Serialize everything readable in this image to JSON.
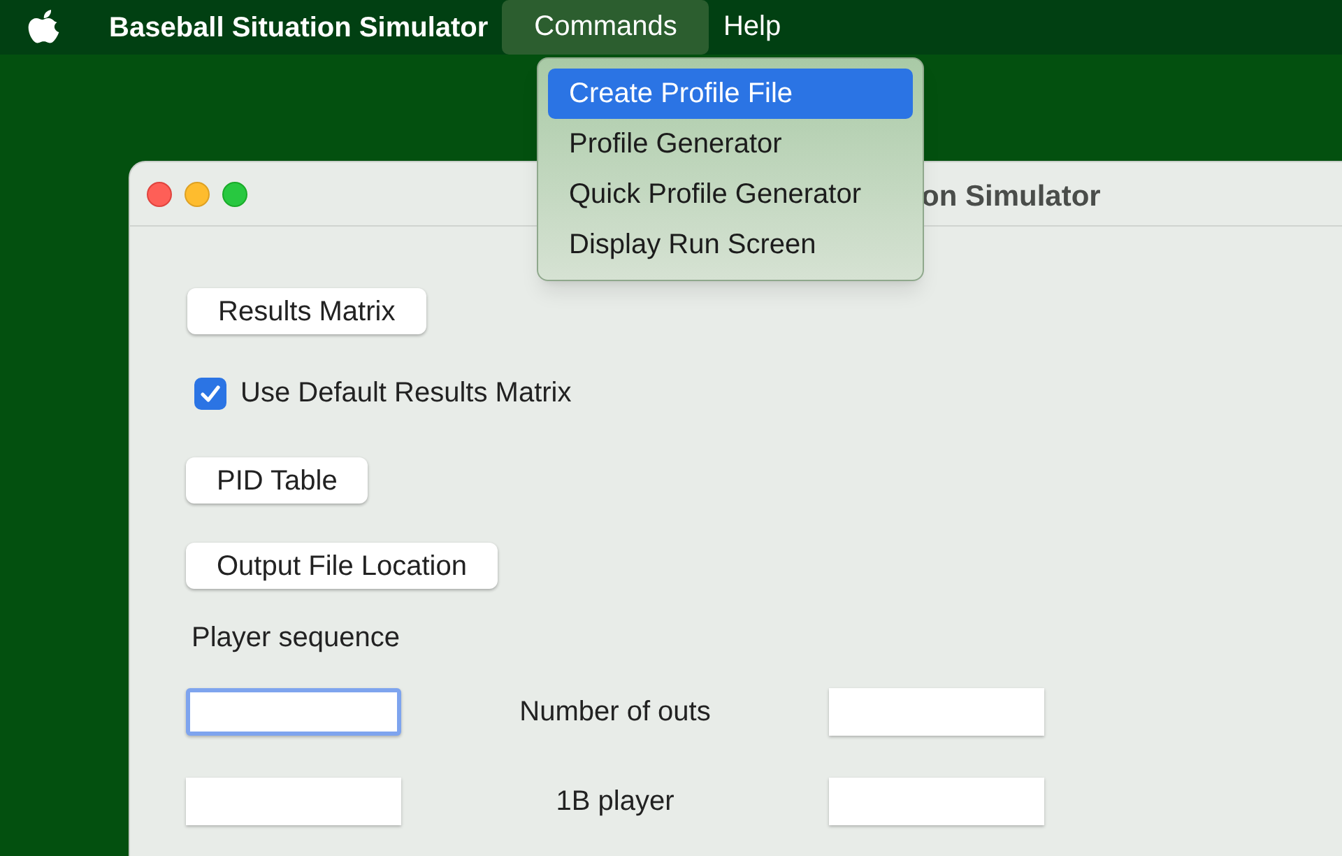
{
  "menu_bar": {
    "app_name": "Baseball Situation Simulator",
    "items": [
      {
        "label": "Commands",
        "selected": true
      },
      {
        "label": "Help",
        "selected": false
      }
    ]
  },
  "menu": {
    "items": [
      {
        "label": "Create Profile File",
        "selected": true
      },
      {
        "label": "Profile Generator",
        "selected": false
      },
      {
        "label": "Quick Profile Generator",
        "selected": false
      },
      {
        "label": "Display Run Screen",
        "selected": false
      }
    ]
  },
  "window": {
    "title": "on Simulator",
    "buttons": [
      "Results Matrix"
    ],
    "checkbox": {
      "label": "Use Default Results Matrix",
      "checked": true
    },
    "buttons_2": [
      "PID Table",
      "Output File Location"
    ],
    "section_label": "Player sequence",
    "rows": [
      {
        "label": "Number of outs",
        "sequence_field": {
          "focused": true
        },
        "value_field": {
          "focused": false
        }
      },
      {
        "label": "1B player",
        "sequence_field": {
          "focused": false
        },
        "value_field": {
          "focused": false
        }
      }
    ]
  }
}
